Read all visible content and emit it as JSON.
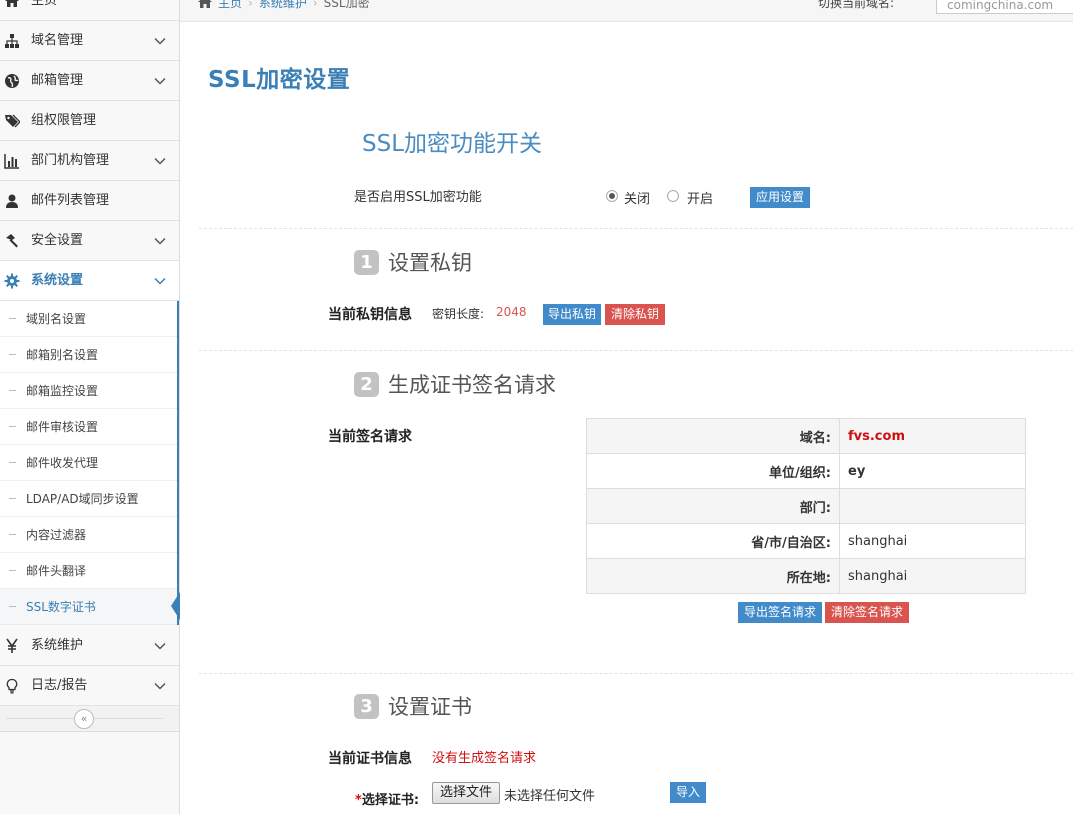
{
  "sidebar": {
    "top_items": [
      {
        "label": "主页",
        "icon": "home-icon",
        "has_chevron": false
      },
      {
        "label": "域名管理",
        "icon": "sitemap-icon",
        "has_chevron": true
      },
      {
        "label": "邮箱管理",
        "icon": "globe-icon",
        "has_chevron": true
      },
      {
        "label": "组权限管理",
        "icon": "tags-icon",
        "has_chevron": false
      },
      {
        "label": "部门机构管理",
        "icon": "bar-chart-icon",
        "has_chevron": true
      },
      {
        "label": "邮件列表管理",
        "icon": "user-icon",
        "has_chevron": false
      },
      {
        "label": "安全设置",
        "icon": "hammer-icon",
        "has_chevron": true
      }
    ],
    "active_item": {
      "label": "系统设置",
      "icon": "gear-icon",
      "has_chevron": true
    },
    "sub_items": [
      {
        "label": "域别名设置"
      },
      {
        "label": "邮箱别名设置"
      },
      {
        "label": "邮箱监控设置"
      },
      {
        "label": "邮件审核设置"
      },
      {
        "label": "邮件收发代理"
      },
      {
        "label": "LDAP/AD域同步设置"
      },
      {
        "label": "内容过滤器"
      },
      {
        "label": "邮件头翻译"
      },
      {
        "label": "SSL数字证书"
      }
    ],
    "selected_sub_index": 8,
    "bottom_items": [
      {
        "label": "系统维护",
        "icon": "yen-icon",
        "has_chevron": true
      },
      {
        "label": "日志/报告",
        "icon": "lightbulb-icon",
        "has_chevron": true
      }
    ],
    "collapse_glyph": "«"
  },
  "topbar": {
    "breadcrumb": [
      "主页",
      "系统维护",
      "SSL加密"
    ],
    "domain_label": "切换当前域名:",
    "domain_value": "comingchina.com"
  },
  "page_title": "SSL加密设置",
  "ssl_switch": {
    "title": "SSL加密功能开关",
    "question": "是否启用SSL加密功能",
    "option_off": "关闭",
    "option_on": "开启",
    "selected": "off",
    "apply_label": "应用设置"
  },
  "step1": {
    "number": "1",
    "title": "设置私钥",
    "field_label": "当前私钥信息",
    "key_length_label": "密钥长度:",
    "key_length_value": "2048",
    "export_label": "导出私钥",
    "clear_label": "清除私钥"
  },
  "step2": {
    "number": "2",
    "title": "生成证书签名请求",
    "field_label": "当前签名请求",
    "rows": [
      {
        "key": "域名:",
        "value": "fvs.com"
      },
      {
        "key": "单位/组织:",
        "value": "ey"
      },
      {
        "key": "部门:",
        "value": ""
      },
      {
        "key": "省/市/自治区:",
        "value": "shanghai"
      },
      {
        "key": "所在地:",
        "value": "shanghai"
      }
    ],
    "export_label": "导出签名请求",
    "clear_label": "清除签名请求"
  },
  "step3": {
    "number": "3",
    "title": "设置证书",
    "field_label": "当前证书信息",
    "no_csr_text": "没有生成签名请求",
    "select_required_mark": "*",
    "select_label": "选择证书:",
    "file_button_label": "选择文件",
    "file_none_text": "未选择任何文件",
    "import_label": "导入"
  },
  "colors": {
    "accent": "#3a7fb5",
    "button_blue": "#428bca",
    "button_red": "#d9534f",
    "alert_red": "#d01010"
  }
}
